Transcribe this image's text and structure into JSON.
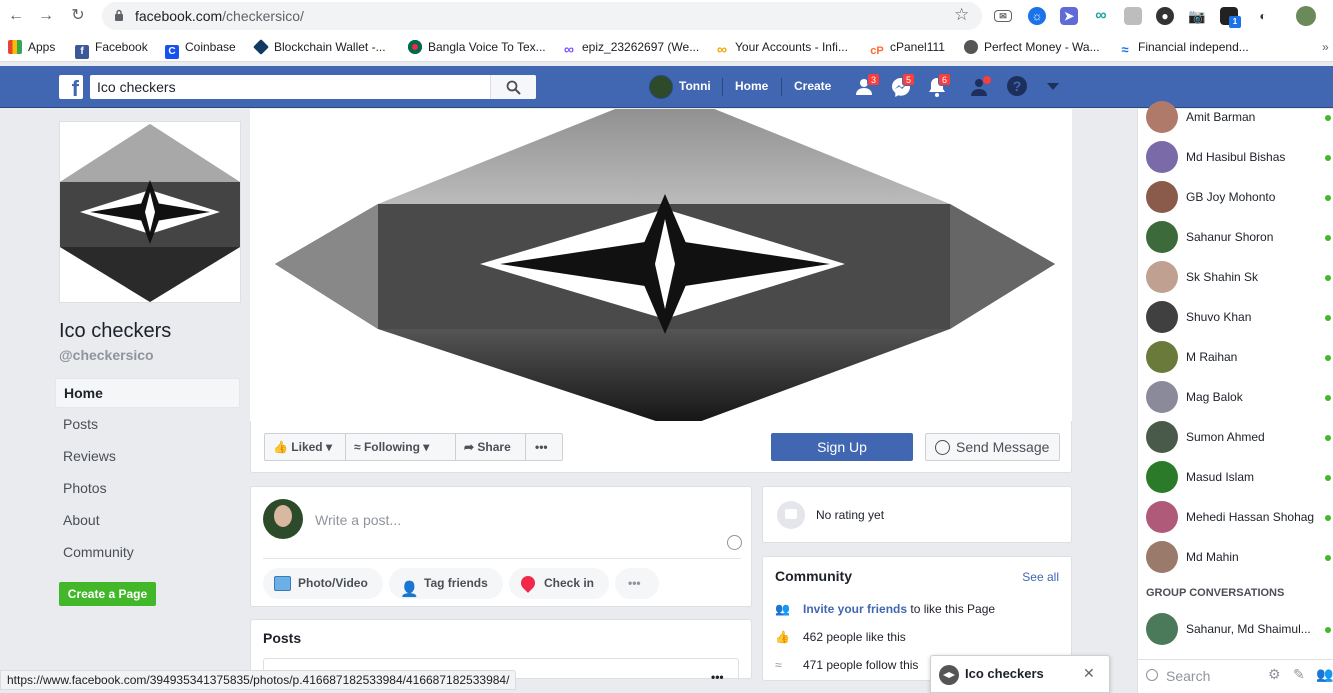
{
  "browser": {
    "url_host": "facebook.com",
    "url_path": "/checkersico/",
    "bookmarks": [
      {
        "label": "Apps",
        "icon": "apps-grid-icon"
      },
      {
        "label": "Facebook",
        "icon": "facebook-icon"
      },
      {
        "label": "Coinbase",
        "icon": "coinbase-icon"
      },
      {
        "label": "Blockchain Wallet -...",
        "icon": "blockchain-icon"
      },
      {
        "label": "Bangla Voice To Tex...",
        "icon": "bangladesh-flag-icon"
      },
      {
        "label": "epiz_23262697 (We...",
        "icon": "infinity-icon"
      },
      {
        "label": "Your Accounts - Infi...",
        "icon": "infinity-icon"
      },
      {
        "label": "cPanel111",
        "icon": "cpanel-icon"
      },
      {
        "label": "Perfect Money - Wa...",
        "icon": "globe-icon"
      },
      {
        "label": "Financial independ...",
        "icon": "waves-icon"
      }
    ],
    "ext_badge": "1",
    "status_url": "https://www.facebook.com/394935341375835/photos/p.416687182533984/416687182533984/"
  },
  "fbbar": {
    "search_value": "Ico checkers",
    "user_name": "Tonni",
    "home_label": "Home",
    "create_label": "Create",
    "friend_requests_count": "3",
    "messages_count": "5",
    "notifications_count": "6"
  },
  "page": {
    "name": "Ico checkers",
    "handle": "@checkersico",
    "nav": [
      "Home",
      "Posts",
      "Reviews",
      "Photos",
      "About",
      "Community"
    ],
    "create_page_label": "Create a Page"
  },
  "actions": {
    "liked": "Liked",
    "following": "Following",
    "share": "Share",
    "more": "•••",
    "signup": "Sign Up",
    "send_message": "Send Message"
  },
  "composer": {
    "placeholder": "Write a post...",
    "photo_video": "Photo/Video",
    "tag_friends": "Tag friends",
    "check_in": "Check in",
    "more": "•••"
  },
  "posts": {
    "heading": "Posts"
  },
  "rating": {
    "text": "No rating yet"
  },
  "community": {
    "title": "Community",
    "see_all": "See all",
    "invite_link": "Invite your friends",
    "invite_rest": " to like this Page",
    "likes": "462 people like this",
    "follows": "471 people follow this"
  },
  "chat": {
    "contacts": [
      {
        "name": "Amit Barman",
        "color": "#b07a6a"
      },
      {
        "name": "Md Hasibul Bishas",
        "color": "#7a6aa8"
      },
      {
        "name": "GB Joy Mohonto",
        "color": "#8a5a4a"
      },
      {
        "name": "Sahanur Shoron",
        "color": "#3d6a3a"
      },
      {
        "name": "Sk Shahin Sk",
        "color": "#c0a090"
      },
      {
        "name": "Shuvo Khan",
        "color": "#404040"
      },
      {
        "name": "M Raihan",
        "color": "#6a7a3a"
      },
      {
        "name": "Mag Balok",
        "color": "#8a8a9a"
      },
      {
        "name": "Sumon Ahmed",
        "color": "#4a5a4a"
      },
      {
        "name": "Masud Islam",
        "color": "#2a7a2a"
      },
      {
        "name": "Mehedi Hassan Shohag",
        "color": "#b05a7a"
      },
      {
        "name": "Md Mahin",
        "color": "#9a7a6a"
      }
    ],
    "group_heading": "GROUP CONVERSATIONS",
    "group_name": "Sahanur, Md Shaimul...",
    "search_placeholder": "Search"
  },
  "chattab": {
    "title": "Ico checkers",
    "close": "✕"
  }
}
